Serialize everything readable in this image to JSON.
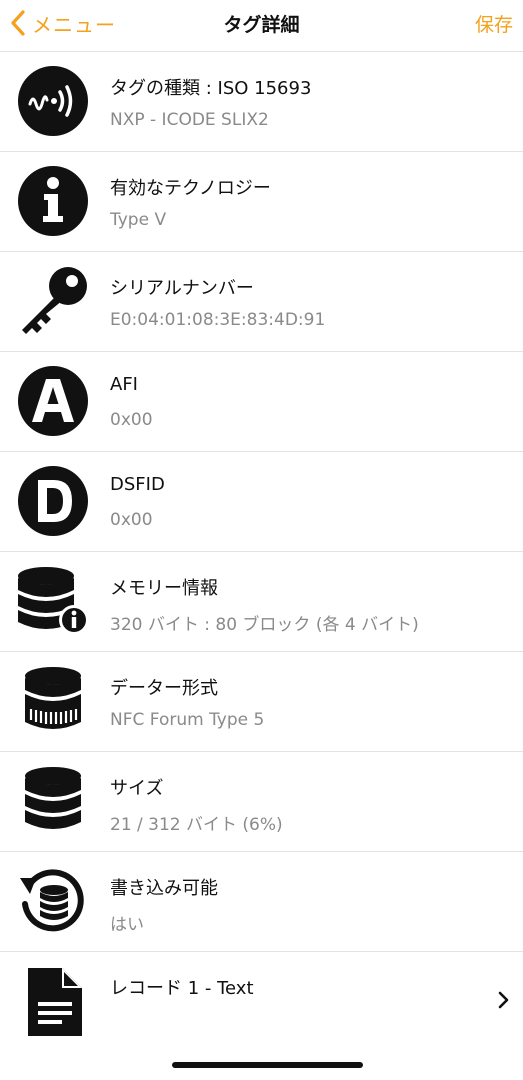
{
  "nav": {
    "back_label": "メニュー",
    "title": "タグ詳細",
    "save_label": "保存"
  },
  "colors": {
    "accent": "#F4A11D",
    "subtitle": "#8a8a8a",
    "separator": "#e3e3e3"
  },
  "rows": [
    {
      "icon": "nfc-wave-icon",
      "title": "タグの種類 : ISO 15693",
      "subtitle": "NXP - ICODE SLIX2"
    },
    {
      "icon": "info-icon",
      "title": "有効なテクノロジー",
      "subtitle": "Type V"
    },
    {
      "icon": "key-icon",
      "title": "シリアルナンバー",
      "subtitle": "E0:04:01:08:3E:83:4D:91"
    },
    {
      "icon": "letter-a-icon",
      "title": "AFI",
      "subtitle": "0x00"
    },
    {
      "icon": "letter-d-icon",
      "title": "DSFID",
      "subtitle": "0x00"
    },
    {
      "icon": "database-info-icon",
      "title": "メモリー情報",
      "subtitle": "320 バイト : 80 ブロック (各 4 バイト)"
    },
    {
      "icon": "database-format-icon",
      "title": "データー形式",
      "subtitle": "NFC Forum Type 5"
    },
    {
      "icon": "database-icon",
      "title": "サイズ",
      "subtitle": "21 / 312 バイト (6%)"
    },
    {
      "icon": "database-refresh-icon",
      "title": "書き込み可能",
      "subtitle": "はい"
    },
    {
      "icon": "document-icon",
      "title": "レコード 1 - Text",
      "subtitle": ""
    }
  ]
}
